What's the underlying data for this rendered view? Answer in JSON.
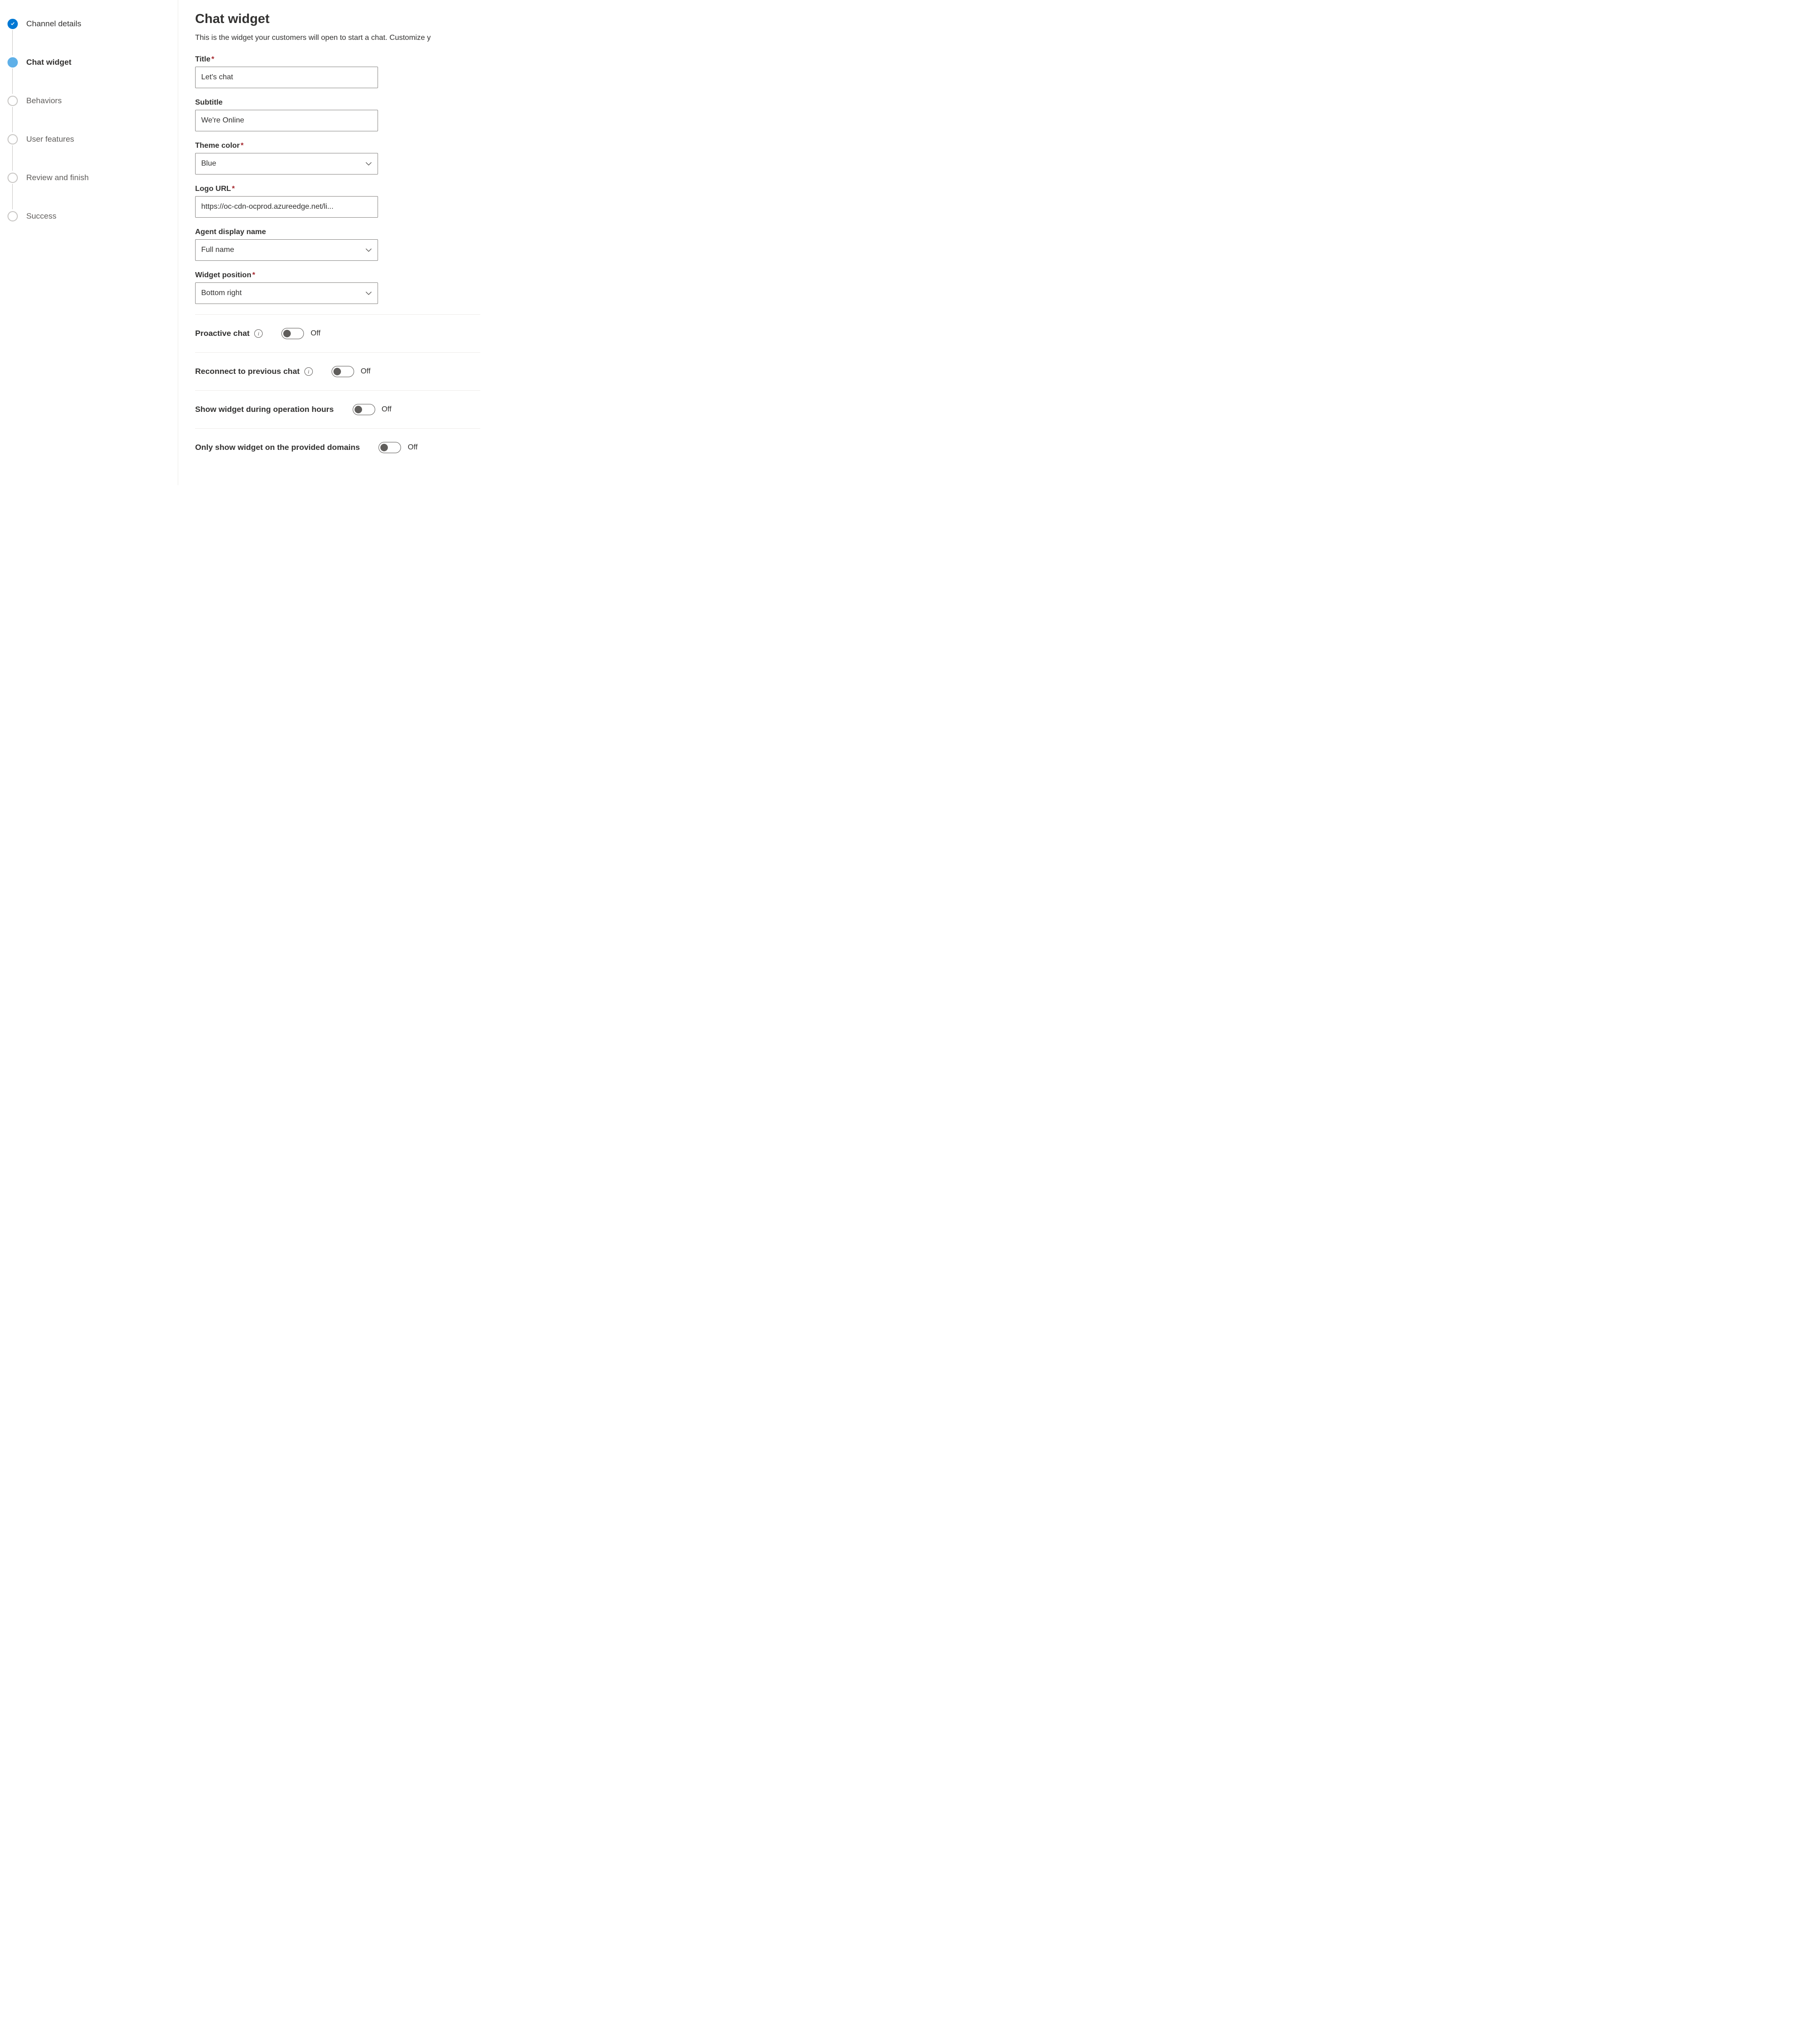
{
  "sidebar": {
    "steps": [
      {
        "label": "Channel details",
        "state": "completed"
      },
      {
        "label": "Chat widget",
        "state": "current"
      },
      {
        "label": "Behaviors",
        "state": "pending"
      },
      {
        "label": "User features",
        "state": "pending"
      },
      {
        "label": "Review and finish",
        "state": "pending"
      },
      {
        "label": "Success",
        "state": "pending"
      }
    ]
  },
  "main": {
    "title": "Chat widget",
    "subtitle": "This is the widget your customers will open to start a chat. Customize y",
    "fields": {
      "title_label": "Title",
      "title_value": "Let's chat",
      "subtitle_label": "Subtitle",
      "subtitle_value": "We're Online",
      "theme_label": "Theme color",
      "theme_value": "Blue",
      "logo_label": "Logo URL",
      "logo_value": "https://oc-cdn-ocprod.azureedge.net/li...",
      "agent_label": "Agent display name",
      "agent_value": "Full name",
      "position_label": "Widget position",
      "position_value": "Bottom right"
    },
    "toggles": {
      "proactive_label": "Proactive chat",
      "proactive_status": "Off",
      "reconnect_label": "Reconnect to previous chat",
      "reconnect_status": "Off",
      "operation_label": "Show widget during operation hours",
      "operation_status": "Off",
      "domains_label": "Only show widget on the provided domains",
      "domains_status": "Off"
    }
  }
}
